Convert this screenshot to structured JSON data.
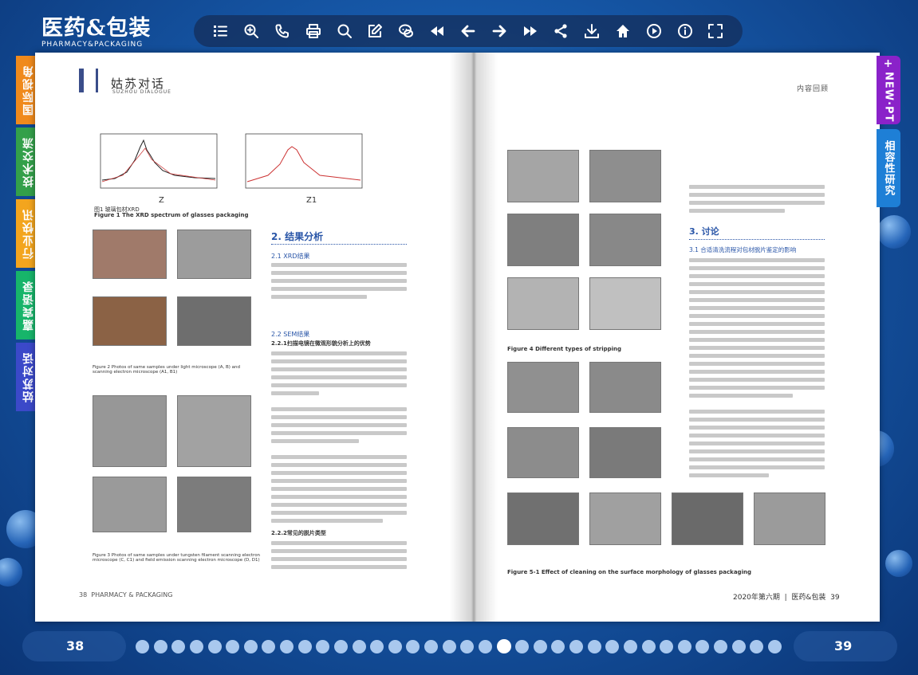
{
  "logo": {
    "cn": "医药&包装",
    "en": "PHARMACY&PACKAGING"
  },
  "toolbar": [
    "list-icon",
    "zoom-in-icon",
    "phone-icon",
    "print-icon",
    "search-icon",
    "edit-icon",
    "chat-icon",
    "first-page-icon",
    "prev-page-icon",
    "next-page-icon",
    "last-page-icon",
    "share-icon",
    "download-icon",
    "home-icon",
    "play-icon",
    "info-icon",
    "fullscreen-icon"
  ],
  "left_tabs": [
    {
      "label": "国际视角",
      "color": "#f08a1c"
    },
    {
      "label": "技术交流",
      "color": "#33a04a"
    },
    {
      "label": "行业快讯",
      "color": "#f3a51e"
    },
    {
      "label": "嘉宾语录",
      "color": "#17b56a"
    },
    {
      "label": "姑苏对话",
      "color": "#3b49c9"
    }
  ],
  "right_tabs": [
    {
      "label": "NEW·PT",
      "color": "#8a22c9"
    },
    {
      "label": "相容性研究",
      "color": "#1e7fd6"
    }
  ],
  "left_page": {
    "header": "姑苏对话",
    "header_en": "SUZHOU DIALOGUE",
    "fig_label_z": "Z",
    "fig_label_z1": "Z1",
    "fig1_cap_cn": "图1 玻璃包材XRD",
    "fig1_cap_en": "Figure 1 The XRD spectrum of glasses packaging",
    "fig2_cap_en": "Figure 2 Photos of same samples under light microscope (A, B) and scanning electron microscope (A1, B1)",
    "fig3_cap_en": "Figure 3 Photos of same samples under tungsten filament scanning electron microscope (C, C1) and field emission scanning electron microscope (D, D1)",
    "section": "2. 结果分析",
    "sub1": "2.1 XRD结果",
    "sub2": "2.2 SEM结果",
    "sub3": "2.2.1扫描电镜在微观形貌分析上的优势",
    "sub4": "2.2.2常见的脱片类型",
    "footer": "38  PHARMACY & PACKAGING"
  },
  "right_page": {
    "header": "内容回顾",
    "section": "3. 讨论",
    "sub1": "3.1 合适清洗流程对包材脱片鉴定的影响",
    "fig4_cap_en": "Figure 4 Different types of stripping",
    "fig5_cap_en": "Figure 5-1 Effect of cleaning on the surface morphology of glasses packaging",
    "footer": "2020年第六期  |  医药&包装  39"
  },
  "pages": {
    "left": "38",
    "right": "39"
  },
  "page_dots": {
    "total": 36,
    "active": 20
  }
}
